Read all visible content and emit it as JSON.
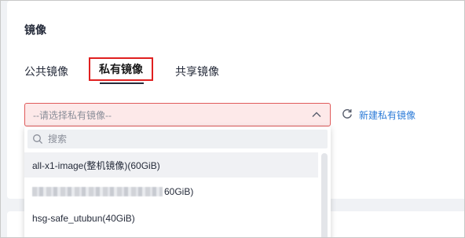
{
  "card": {
    "title": "镜像"
  },
  "tabs": [
    {
      "label": "公共镜像",
      "selected": false
    },
    {
      "label": "私有镜像",
      "selected": true
    },
    {
      "label": "共享镜像",
      "selected": false
    }
  ],
  "select": {
    "placeholder": "--请选择私有镜像--",
    "expanded": true
  },
  "actions": {
    "new_label": "新建私有镜像",
    "refresh_icon": "refresh-icon"
  },
  "dropdown": {
    "search_placeholder": "搜索",
    "options": [
      {
        "label": "all-x1-image(整机镜像)(60GiB)"
      },
      {
        "label": "60GiB)",
        "redacted": true
      },
      {
        "label": "hsg-safe_utubun(40GiB)"
      }
    ]
  },
  "colors": {
    "accent_link": "#2b7bd8",
    "error_border": "#e05a5a",
    "highlight_box": "#e02020"
  }
}
